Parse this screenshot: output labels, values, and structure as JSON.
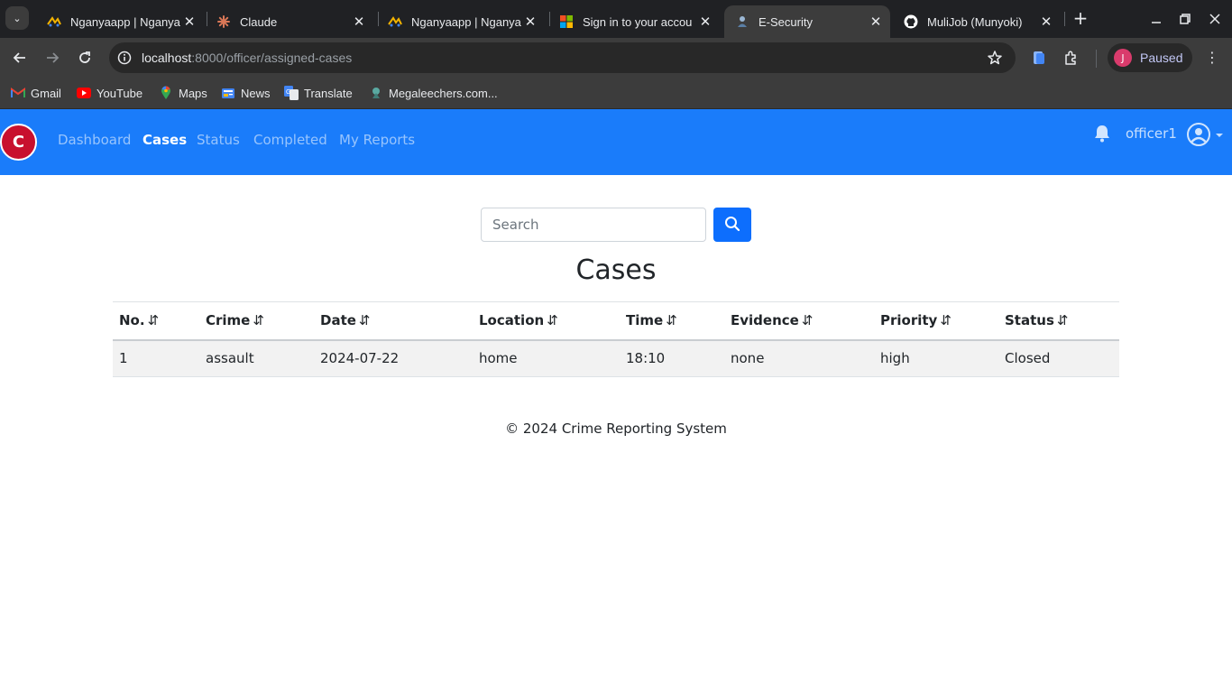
{
  "browser": {
    "tabs": [
      {
        "title": "Nganyaapp | Nganya",
        "icon": "nganya-logo-icon"
      },
      {
        "title": "Claude",
        "icon": "claude-logo-icon"
      },
      {
        "title": "Nganyaapp | Nganya",
        "icon": "nganya-logo-icon"
      },
      {
        "title": "Sign in to your accou",
        "icon": "microsoft-logo-icon"
      },
      {
        "title": "E-Security",
        "icon": "e-security-favicon-icon",
        "active": true
      },
      {
        "title": "MuliJob (Munyoki)",
        "icon": "github-logo-icon"
      }
    ],
    "url_host": "localhost",
    "url_path": ":8000/officer/assigned-cases",
    "profile_initial": "J",
    "profile_label": "Paused",
    "bookmarks": [
      {
        "label": "Gmail",
        "icon": "gmail-icon"
      },
      {
        "label": "YouTube",
        "icon": "youtube-icon"
      },
      {
        "label": "Maps",
        "icon": "maps-icon"
      },
      {
        "label": "News",
        "icon": "news-icon"
      },
      {
        "label": "Translate",
        "icon": "translate-icon"
      },
      {
        "label": "Megaleechers.com...",
        "icon": "megaleechers-icon"
      }
    ]
  },
  "navbar": {
    "brand_letter": "C",
    "links": [
      "Dashboard",
      "Cases",
      "Status",
      "Completed",
      "My Reports"
    ],
    "active_link": "Cases",
    "username": "officer1"
  },
  "search": {
    "placeholder": "Search",
    "value": ""
  },
  "main": {
    "title": "Cases",
    "sort_glyph": "⇵",
    "columns": [
      "No.",
      "Crime",
      "Date",
      "Location",
      "Time",
      "Evidence",
      "Priority",
      "Status"
    ],
    "rows": [
      [
        "1",
        "assault",
        "2024-07-22",
        "home",
        "18:10",
        "none",
        "high",
        "Closed"
      ]
    ]
  },
  "footer": {
    "text": "© 2024 Crime Reporting System"
  },
  "colors": {
    "navbar_bg": "#1a7cfa",
    "search_button": "#0d6efd",
    "brand_red": "#c8102e",
    "row_bg": "#f2f2f2"
  }
}
